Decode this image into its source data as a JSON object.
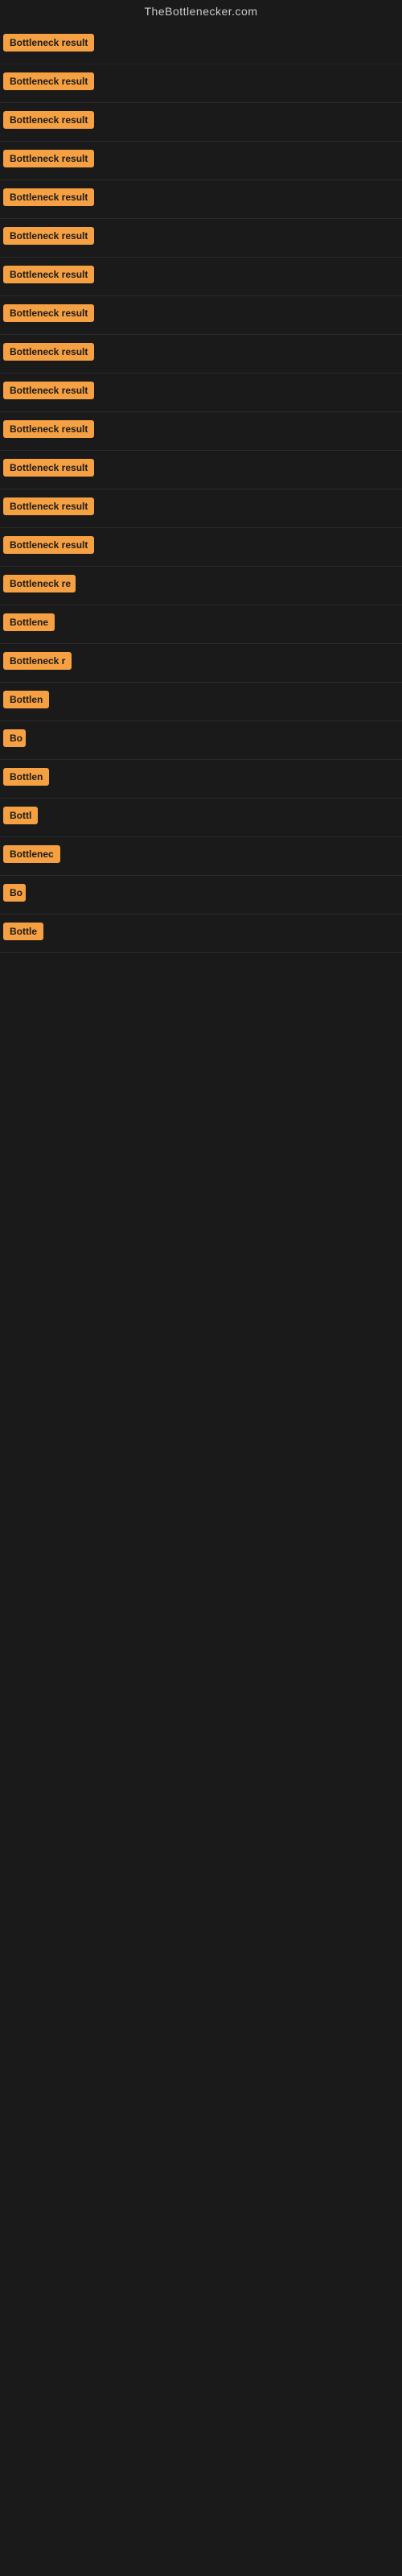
{
  "site": {
    "title": "TheBottlenecker.com"
  },
  "rows": [
    {
      "id": 1,
      "label": "Bottleneck result",
      "width": 120
    },
    {
      "id": 2,
      "label": "Bottleneck result",
      "width": 120
    },
    {
      "id": 3,
      "label": "Bottleneck result",
      "width": 120
    },
    {
      "id": 4,
      "label": "Bottleneck result",
      "width": 120
    },
    {
      "id": 5,
      "label": "Bottleneck result",
      "width": 120
    },
    {
      "id": 6,
      "label": "Bottleneck result",
      "width": 120
    },
    {
      "id": 7,
      "label": "Bottleneck result",
      "width": 120
    },
    {
      "id": 8,
      "label": "Bottleneck result",
      "width": 120
    },
    {
      "id": 9,
      "label": "Bottleneck result",
      "width": 120
    },
    {
      "id": 10,
      "label": "Bottleneck result",
      "width": 120
    },
    {
      "id": 11,
      "label": "Bottleneck result",
      "width": 120
    },
    {
      "id": 12,
      "label": "Bottleneck result",
      "width": 120
    },
    {
      "id": 13,
      "label": "Bottleneck result",
      "width": 120
    },
    {
      "id": 14,
      "label": "Bottleneck result",
      "width": 120
    },
    {
      "id": 15,
      "label": "Bottleneck re",
      "width": 90
    },
    {
      "id": 16,
      "label": "Bottlene",
      "width": 70
    },
    {
      "id": 17,
      "label": "Bottleneck r",
      "width": 85
    },
    {
      "id": 18,
      "label": "Bottlen",
      "width": 62
    },
    {
      "id": 19,
      "label": "Bo",
      "width": 28
    },
    {
      "id": 20,
      "label": "Bottlen",
      "width": 62
    },
    {
      "id": 21,
      "label": "Bottl",
      "width": 46
    },
    {
      "id": 22,
      "label": "Bottlenec",
      "width": 76
    },
    {
      "id": 23,
      "label": "Bo",
      "width": 28
    },
    {
      "id": 24,
      "label": "Bottle",
      "width": 52
    }
  ]
}
